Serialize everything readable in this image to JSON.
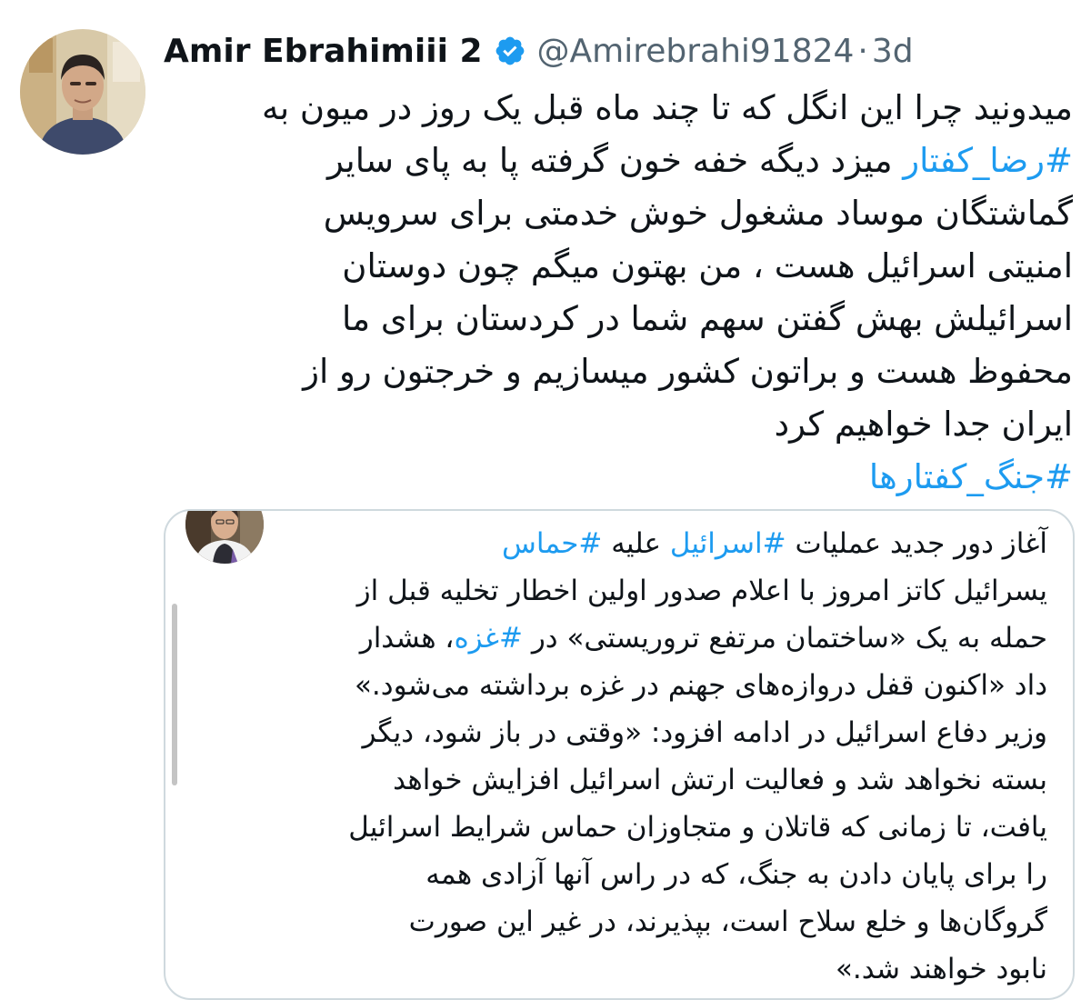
{
  "author": {
    "display_name": "Amir Ebrahimiii 2",
    "handle": "@Amirebrahi91824",
    "separator": "·",
    "time": "3d",
    "verified_icon": "verified-badge-icon",
    "colors": {
      "verified": "#1d9bf0"
    }
  },
  "tweet": {
    "lines": [
      [
        {
          "text": "میدونید چرا این انگل که تا چند ماه قبل یک روز در میون به",
          "tag": false
        }
      ],
      [
        {
          "text": "#رضا_کفتار",
          "tag": true
        },
        {
          "text": " میزد دیگه خفه خون گرفته پا به پای سایر",
          "tag": false
        }
      ],
      [
        {
          "text": "گماشتگان موساد مشغول خوش خدمتی برای سرویس",
          "tag": false
        }
      ],
      [
        {
          "text": "امنیتی اسرائیل هست  ، من بهتون میگم چون دوستان",
          "tag": false
        }
      ],
      [
        {
          "text": "اسرائیلش  بهش گفتن سهم شما در کردستان برای ما",
          "tag": false
        }
      ],
      [
        {
          "text": "محفوظ هست و براتون کشور میسازیم و خرجتون رو از",
          "tag": false
        }
      ],
      [
        {
          "text": "ایران جدا خواهیم کرد",
          "tag": false
        }
      ],
      [
        {
          "text": "#جنگ_کفتارها",
          "tag": true
        }
      ]
    ]
  },
  "quote": {
    "lines": [
      [
        {
          "text": "آغاز دور جدید عملیات ",
          "tag": false
        },
        {
          "text": "#اسرائیل",
          "tag": true
        },
        {
          "text": " علیه ",
          "tag": false
        },
        {
          "text": "#حماس",
          "tag": true
        }
      ],
      [
        {
          "text": "یسرائیل کاتز امروز با اعلام صدور اولین اخطار تخلیه قبل از",
          "tag": false
        }
      ],
      [
        {
          "text": "حمله به یک «ساختمان مرتفع تروریستی» در ",
          "tag": false
        },
        {
          "text": "#غزه",
          "tag": true
        },
        {
          "text": "، هشدار",
          "tag": false
        }
      ],
      [
        {
          "text": "داد «اکنون قفل دروازه‌های جهنم در غزه برداشته می‌شود.»",
          "tag": false
        }
      ],
      [
        {
          "text": "وزیر دفاع اسرائیل در ادامه افزود: «وقتی در باز شود، دیگر",
          "tag": false
        }
      ],
      [
        {
          "text": "بسته نخواهد شد و فعالیت ارتش اسرائیل افزایش خواهد",
          "tag": false
        }
      ],
      [
        {
          "text": "یافت، تا زمانی که قاتلان و متجاوزان حماس شرایط اسرائیل",
          "tag": false
        }
      ],
      [
        {
          "text": "را برای پایان دادن به جنگ، که در راس آنها آزادی همه",
          "tag": false
        }
      ],
      [
        {
          "text": "گروگان‌ها و خلع سلاح است، بپذیرند، در غیر این صورت",
          "tag": false
        }
      ],
      [
        {
          "text": "نابود خواهند شد.»",
          "tag": false
        }
      ]
    ]
  }
}
